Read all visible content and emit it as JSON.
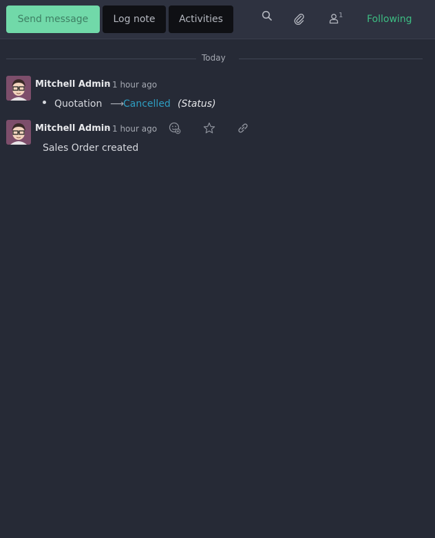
{
  "topbar": {
    "send_message_label": "Send message",
    "log_note_label": "Log note",
    "activities_label": "Activities",
    "follower_count": "1",
    "following_label": "Following"
  },
  "thread": {
    "date_separator": "Today",
    "messages": [
      {
        "author": "Mitchell Admin",
        "dash": "-",
        "time": "1 hour ago",
        "tracking": {
          "field_value": "Quotation",
          "arrow": "⟶",
          "new_value": "Cancelled",
          "field_name": "(Status)"
        }
      },
      {
        "author": "Mitchell Admin",
        "dash": "-",
        "time": "1 hour ago",
        "body": "Sales Order created"
      }
    ]
  },
  "icons": {
    "search": "search-icon",
    "attachment": "paperclip-icon",
    "followers": "user-icon",
    "reaction": "add-reaction-icon",
    "star": "star-icon",
    "link": "link-icon"
  },
  "colors": {
    "send_button": "#71d9a9",
    "following": "#3dbd83",
    "new_value": "#2e9ec2",
    "background": "#262a36"
  }
}
